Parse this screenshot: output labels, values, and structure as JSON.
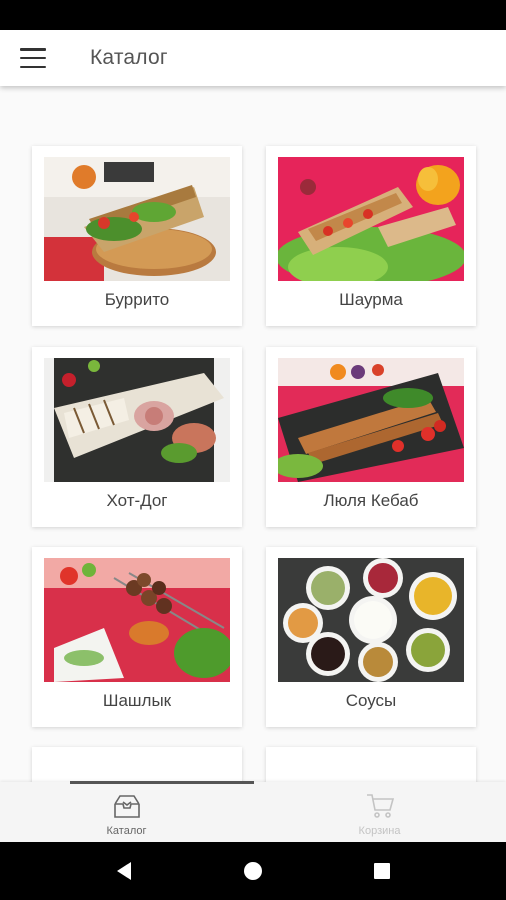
{
  "app_bar": {
    "title": "Каталог",
    "menu_icon": "hamburger-menu-icon"
  },
  "catalog": {
    "items": [
      {
        "label": "Буррито"
      },
      {
        "label": "Шаурма"
      },
      {
        "label": "Хот-Дог"
      },
      {
        "label": "Люля Кебаб"
      },
      {
        "label": "Шашлык"
      },
      {
        "label": "Соусы"
      }
    ]
  },
  "bottom_nav": {
    "items": [
      {
        "label": "Каталог",
        "icon": "catalog-box-icon",
        "active": true
      },
      {
        "label": "Корзина",
        "icon": "cart-icon",
        "active": false
      }
    ]
  },
  "system_nav": {
    "back_icon": "back-triangle-icon",
    "home_icon": "home-circle-icon",
    "recents_icon": "recents-square-icon"
  },
  "colors": {
    "app_bar": "#ffffff",
    "background": "#fafafa",
    "active_label": "#666666",
    "inactive_label": "#c4c4c4"
  }
}
